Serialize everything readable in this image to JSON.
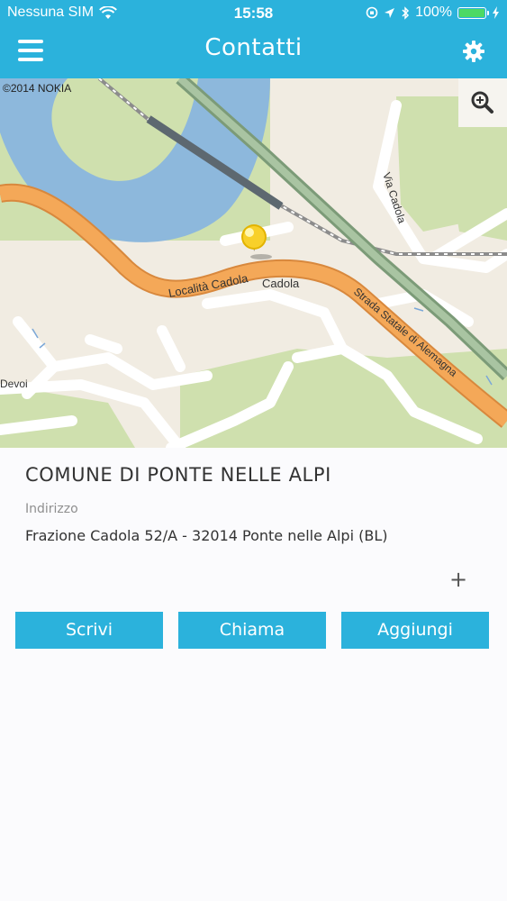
{
  "status_bar": {
    "carrier": "Nessuna SIM",
    "time": "15:58",
    "battery_percent_label": "100%",
    "battery_level": 1.0
  },
  "navbar": {
    "title": "Contatti",
    "menu_icon": "hamburger-menu-icon",
    "settings_icon": "gear-icon"
  },
  "map": {
    "copyright": "©2014 NOKIA",
    "labels": {
      "road_main": "Località Cadola",
      "town": "Cadola",
      "road_right": "Strada Statale di Alemagna",
      "road_top": "Via Cadola",
      "left": "Devoi"
    },
    "zoom_icon": "magnifier-zoom-icon"
  },
  "contact": {
    "name": "COMUNE DI PONTE NELLE ALPI",
    "address_label": "Indirizzo",
    "address": "Frazione Cadola 52/A - 32014 Ponte nelle Alpi (BL)",
    "expand_symbol": "+"
  },
  "actions": {
    "write": "Scrivi",
    "call": "Chiama",
    "add": "Aggiungi"
  },
  "colors": {
    "header": "#2bb2dc",
    "button": "#2bb2dc",
    "water": "#8db8dc",
    "park": "#cfe0ae",
    "road_major": "#f4a858",
    "highway": "#8fae8a"
  }
}
